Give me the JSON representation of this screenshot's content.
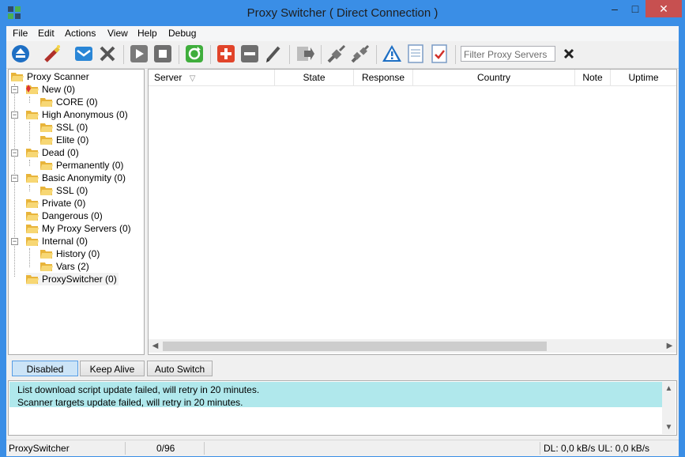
{
  "window": {
    "title": "Proxy Switcher ( Direct Connection )",
    "controls": {
      "minimize": "–",
      "maximize": "□",
      "close": "✕"
    },
    "accent_color": "#3a8ee6",
    "close_color": "#c75050"
  },
  "menu": [
    "File",
    "Edit",
    "Actions",
    "View",
    "Help",
    "Debug"
  ],
  "toolbar": {
    "icons": [
      "eject-icon",
      "wand-icon",
      "mail-icon",
      "delete-icon",
      "play-icon",
      "stop-icon",
      "refresh-icon",
      "add-icon",
      "remove-icon",
      "edit-icon",
      "export-icon",
      "connect-icon",
      "disconnect-icon",
      "warning-icon",
      "document-icon",
      "checklist-icon"
    ],
    "filter_placeholder": "Filter Proxy Servers"
  },
  "tree": {
    "root": "Proxy Scanner",
    "nodes": [
      {
        "label": "New (0)",
        "level": 1
      },
      {
        "label": "CORE (0)",
        "level": 2
      },
      {
        "label": "High Anonymous (0)",
        "level": 1
      },
      {
        "label": "SSL (0)",
        "level": 2
      },
      {
        "label": "Elite (0)",
        "level": 2
      },
      {
        "label": "Dead (0)",
        "level": 1
      },
      {
        "label": "Permanently (0)",
        "level": 2
      },
      {
        "label": "Basic Anonymity (0)",
        "level": 1
      },
      {
        "label": "SSL (0)",
        "level": 2
      },
      {
        "label": "Private (0)",
        "level": 1
      },
      {
        "label": "Dangerous (0)",
        "level": 1
      },
      {
        "label": "My Proxy Servers (0)",
        "level": 1
      },
      {
        "label": "Internal (0)",
        "level": 1
      },
      {
        "label": "History (0)",
        "level": 2
      },
      {
        "label": "Vars (2)",
        "level": 2
      },
      {
        "label": "ProxySwitcher (0)",
        "level": 1
      }
    ]
  },
  "grid": {
    "columns": [
      "Server",
      "State",
      "Response",
      "Country",
      "Note",
      "Uptime"
    ],
    "sort_indicator": "▽"
  },
  "buttons": {
    "disabled": "Disabled",
    "keep_alive": "Keep Alive",
    "auto_switch": "Auto Switch"
  },
  "log": [
    "List download script update failed, will retry in 20 minutes.",
    "Scanner targets update failed, will retry in 20 minutes."
  ],
  "status": {
    "app": "ProxySwitcher",
    "count": "0/96",
    "speed": "DL: 0,0 kB/s UL: 0,0 kB/s"
  }
}
